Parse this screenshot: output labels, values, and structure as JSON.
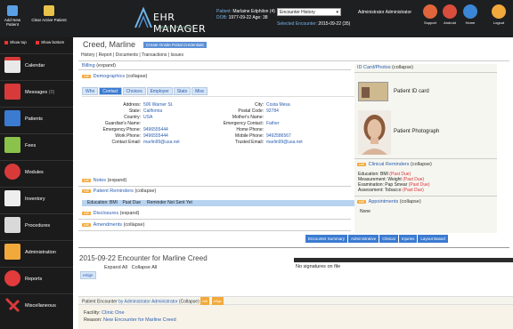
{
  "topbar": {
    "add_new_patient": "Add New Patient",
    "clear_active_patient": "Clear Active Patient",
    "logo_text": "EHR MANAGER",
    "logo_sub": "MEDICAL PRACTICE",
    "patient_label": "Patient:",
    "patient_name": "Marlaine Edphilon (4)",
    "dob_label": "DOB:",
    "dob_value": "1977-09-22 Age: 38",
    "selected_label": "Selected Encounter:",
    "selected_value": "2015-09-22 (35)",
    "encounter_history": "Encounter History",
    "admin_name": "Administrator Administrator",
    "right_icons": [
      {
        "label": "Support",
        "color": "#e0653a"
      },
      {
        "label": "Android",
        "color": "#d94d3d"
      },
      {
        "label": "Home",
        "color": "#3b87d6"
      },
      {
        "label": "Logout",
        "color": "#f2a93b"
      }
    ]
  },
  "sidebar": {
    "show_top": "Show top",
    "show_bottom": "Show bottom",
    "items": [
      {
        "label": "Calendar",
        "icon": "calendar-icon",
        "color": "#e9e9e9"
      },
      {
        "label": "Messages",
        "icon": "mail-icon",
        "color": "#d83a3a",
        "badge": "(0)"
      },
      {
        "label": "Patients",
        "icon": "patients-icon",
        "color": "#3b7bd1"
      },
      {
        "label": "Fees",
        "icon": "fees-icon",
        "color": "#8bc34a"
      },
      {
        "label": "Modules",
        "icon": "modules-icon",
        "color": "#d83a3a"
      },
      {
        "label": "Inventory",
        "icon": "inventory-icon",
        "color": "#eee"
      },
      {
        "label": "Procedures",
        "icon": "procedures-icon",
        "color": "#d9d9d9"
      },
      {
        "label": "Administration",
        "icon": "admin-icon",
        "color": "#f2a93b"
      },
      {
        "label": "Reports",
        "icon": "reports-icon",
        "color": "#e23b3b"
      },
      {
        "label": "Miscellaneous",
        "icon": "misc-icon",
        "color": "#555"
      }
    ]
  },
  "main": {
    "patient_title": "Creed, Marline",
    "portal_button": "Create Onsite Portal Credentials",
    "history_links": "History | Report | Documents | Transactions | Issues",
    "billing": {
      "label": "Billing",
      "state": "(expand)"
    },
    "demographics": {
      "label": "Demographics",
      "state": "(collapse)"
    },
    "tabs": [
      "Who",
      "Contact",
      "Choices",
      "Employer",
      "Stats",
      "Misc"
    ],
    "contact_left": [
      {
        "field": "Address:",
        "value": "506 Warner St."
      },
      {
        "field": "State:",
        "value": "California"
      },
      {
        "field": "Country:",
        "value": "USA"
      },
      {
        "field": "Guardian's Name:",
        "value": ""
      },
      {
        "field": "Emergency Phone:",
        "value": "9496555444"
      },
      {
        "field": "Work Phone:",
        "value": "9496555444"
      },
      {
        "field": "Contact Email:",
        "value": "marlin99@usa.net"
      }
    ],
    "contact_right": [
      {
        "field": "City:",
        "value": "Costa Mesa"
      },
      {
        "field": "Postal Code:",
        "value": "92784"
      },
      {
        "field": "Mother's Name:",
        "value": ""
      },
      {
        "field": "Emergency Contact:",
        "value": "Father"
      },
      {
        "field": "Home Phone:",
        "value": ""
      },
      {
        "field": "Mobile Phone:",
        "value": "9492586567"
      },
      {
        "field": "Trusted Email:",
        "value": "marlin99@usa.net"
      }
    ],
    "notes": {
      "label": "Notes",
      "state": "(expand)"
    },
    "patient_reminders": {
      "label": "Patient Reminders",
      "state": "(collapse)"
    },
    "reminder_row": {
      "item": "Education: BMI",
      "status": "Past Due",
      "note": "Reminder Not Sent Yet"
    },
    "disclosures": {
      "label": "Disclosures",
      "state": "(expand)"
    },
    "amendments": {
      "label": "Amendments",
      "state": "(collapse)"
    },
    "edit_label": "edit",
    "encounter_buttons": [
      "Encounter Summary",
      "Administrative",
      "Clinical",
      "Injuries",
      "Layout Based"
    ],
    "encounter_title": "2015-09-22 Encounter for Marline Creed",
    "expand_all": "Expand All",
    "collapse_all": "Collapse All",
    "esign": "eSign",
    "no_signatures": "No signatures on file",
    "patient_encounter": {
      "prefix": "Patient Encounter",
      "by": "by Administrator Administrator",
      "state": "(Collapse)",
      "esign": "eSign",
      "facility_label": "Facility:",
      "facility_value": "Clinic One",
      "reason_label": "Reason:",
      "reason_value": "New Encounter for Marline Creed"
    }
  },
  "right_panel": {
    "id_card": {
      "label": "ID Card/Photos",
      "state": "(collapse)"
    },
    "patient_id_card": "Patient ID card",
    "patient_photograph": "Patient Photograph",
    "clinical_reminders": {
      "label": "Clinical Reminders",
      "state": "(collapse)"
    },
    "reminders": [
      {
        "item": "Education: BMI",
        "status": "(Past Due)"
      },
      {
        "item": "Measurement: Weight",
        "status": "(Past Due)"
      },
      {
        "item": "Examination: Pap Smear",
        "status": "(Past Due)"
      },
      {
        "item": "Assessment: Tobacco",
        "status": "(Past Due)"
      }
    ],
    "appointments": {
      "label": "Appointments",
      "state": "(collapse)"
    },
    "appointments_value": "None"
  }
}
